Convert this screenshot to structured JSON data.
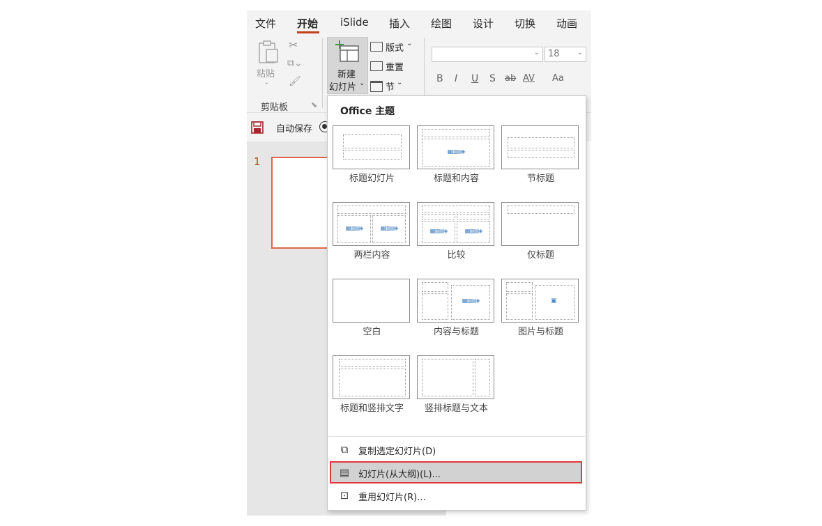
{
  "tabs": [
    "文件",
    "开始",
    "iSlide",
    "插入",
    "绘图",
    "设计",
    "切换",
    "动画"
  ],
  "active_tab": "开始",
  "ribbon": {
    "paste_label": "粘贴",
    "clipboard_group": "剪贴板",
    "new_slide_line1": "新建",
    "new_slide_line2": "幻灯片",
    "layout_label": "版式",
    "reset_label": "重置",
    "section_label": "节",
    "font_size": "18",
    "bold": "B",
    "italic": "I",
    "underline": "U",
    "shadow": "S",
    "strikethrough": "ab",
    "spacing": "AV",
    "change_case": "Aa"
  },
  "qat": {
    "autosave_label": "自动保存"
  },
  "slides": {
    "first_number": "1"
  },
  "dropdown": {
    "theme_title": "Office 主题",
    "layouts": [
      "标题幻灯片",
      "标题和内容",
      "节标题",
      "两栏内容",
      "比较",
      "仅标题",
      "空白",
      "内容与标题",
      "图片与标题",
      "标题和竖排文字",
      "竖排标题与文本"
    ],
    "menu": [
      {
        "label": "复制选定幻灯片(D)",
        "icon": "duplicate-slide-icon"
      },
      {
        "label": "幻灯片(从大纲)(L)...",
        "icon": "outline-document-icon"
      },
      {
        "label": "重用幻灯片(R)...",
        "icon": "reuse-slide-icon"
      }
    ],
    "selected_index": 1
  },
  "colors": {
    "accent": "#c43e1c",
    "selection_border": "#e0393e",
    "selection_bg": "#d2d2d2"
  }
}
